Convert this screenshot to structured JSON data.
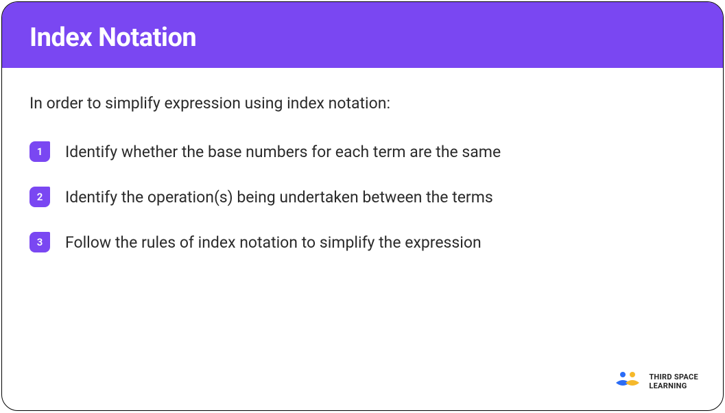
{
  "header": {
    "title": "Index Notation"
  },
  "content": {
    "intro": "In order to simplify expression using index notation:",
    "steps": [
      {
        "num": "1",
        "text": "Identify whether the base numbers for each term are the same"
      },
      {
        "num": "2",
        "text": "Identify the operation(s) being undertaken between the terms"
      },
      {
        "num": "3",
        "text": "Follow the rules of index notation to simplify the expression"
      }
    ]
  },
  "brand": {
    "line1": "THIRD SPACE",
    "line2": "LEARNING"
  }
}
